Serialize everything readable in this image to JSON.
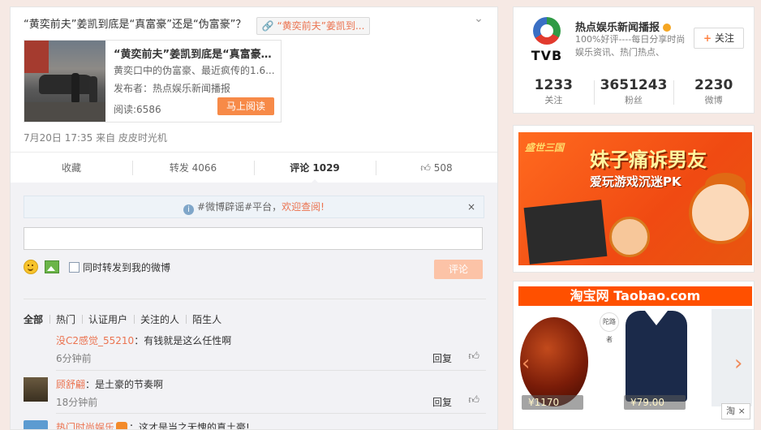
{
  "post": {
    "text": "“黄奕前夫”姜凯到底是“真富豪”还是“伪富豪”？",
    "link_chip": "“黄奕前夫”姜凯到...",
    "article": {
      "title": "“黄奕前夫”姜凯到底是“真富豪”...",
      "desc": "黄奕口中的伪富豪、最近疯传的1.6...",
      "publisher": "发布者：热点娱乐新闻播报",
      "reads": "阅读:6586",
      "read_button": "马上阅读"
    },
    "meta": "7月20日 17:35 来自 皮皮时光机"
  },
  "actions": {
    "favorite": "收藏",
    "repost": "转发 4066",
    "comment": "评论 1029",
    "like": "508"
  },
  "comment_box": {
    "notice_tag": "#微博辟谣#平台，",
    "notice_link": "欢迎查阅",
    "notice_bang": "!",
    "notice_close": "×",
    "repost_label": "同时转发到我的微博",
    "submit_label": "评论"
  },
  "comment_tabs": [
    "全部",
    "热门",
    "认证用户",
    "关注的人",
    "陌生人"
  ],
  "comments": [
    {
      "user": "没C2感觉_55210",
      "text": "：有钱就是这么任性啊",
      "time": "6分钟前",
      "reply": "回复"
    },
    {
      "user": "顾舒翩",
      "text": "：是土豪的节奏啊",
      "time": "18分钟前",
      "reply": "回复"
    },
    {
      "user": "热门时尚娱乐",
      "text": "：这才是当之无愧的真土豪!",
      "time": "",
      "reply": ""
    }
  ],
  "profile": {
    "logo_text": "TVB",
    "name": "热点娱乐新闻播报",
    "desc": "100%好评----每日分享时尚娱乐资讯、热门热点、",
    "follow_label": "关注",
    "stats": [
      {
        "num": "1233",
        "label": "关注"
      },
      {
        "num": "3651243",
        "label": "粉丝"
      },
      {
        "num": "2230",
        "label": "微博"
      }
    ]
  },
  "ad_game": {
    "logo": "盛世三国",
    "title": "妹子痛诉男友",
    "subtitle": "爱玩游戏沉迷PK"
  },
  "ad_taobao": {
    "header": "淘宝网 Taobao.com",
    "prices": [
      "¥1170",
      "¥79.00"
    ],
    "brand_tag": "陀路者",
    "corner_label": "淘 ×"
  },
  "colors": {
    "accent": "#eb7350",
    "taobao": "#ff5000"
  }
}
